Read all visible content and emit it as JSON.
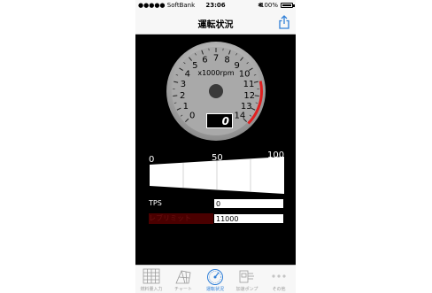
{
  "status": {
    "carrier": "●●●●● SoftBank",
    "time": "23:06",
    "battery": "100%"
  },
  "nav": {
    "title": "運転状況"
  },
  "gauge": {
    "unit": "x1000rpm",
    "ticks": [
      "0",
      "1",
      "2",
      "3",
      "4",
      "5",
      "6",
      "7",
      "8",
      "9",
      "10",
      "11",
      "12",
      "13",
      "14"
    ],
    "redline_from": 11,
    "max": 14,
    "odometer": "0"
  },
  "tps_scale": {
    "min": "0",
    "mid": "50",
    "max": "100"
  },
  "rows": [
    {
      "label": "TPS",
      "value": "0"
    },
    {
      "label": "レブリミット",
      "value": "11000"
    }
  ],
  "tabs": [
    {
      "label": "燃料量入力",
      "icon": "grid-icon",
      "active": false
    },
    {
      "label": "チャート",
      "icon": "chart-icon",
      "active": false
    },
    {
      "label": "運転状況",
      "icon": "speedometer-icon",
      "active": true
    },
    {
      "label": "加速ポンプ",
      "icon": "pump-icon",
      "active": false
    },
    {
      "label": "その他",
      "icon": "more-icon",
      "active": false
    }
  ],
  "colors": {
    "redline": "#e02020",
    "accent": "#2f7fd8",
    "rpm_label_bg": "#4a0000"
  }
}
